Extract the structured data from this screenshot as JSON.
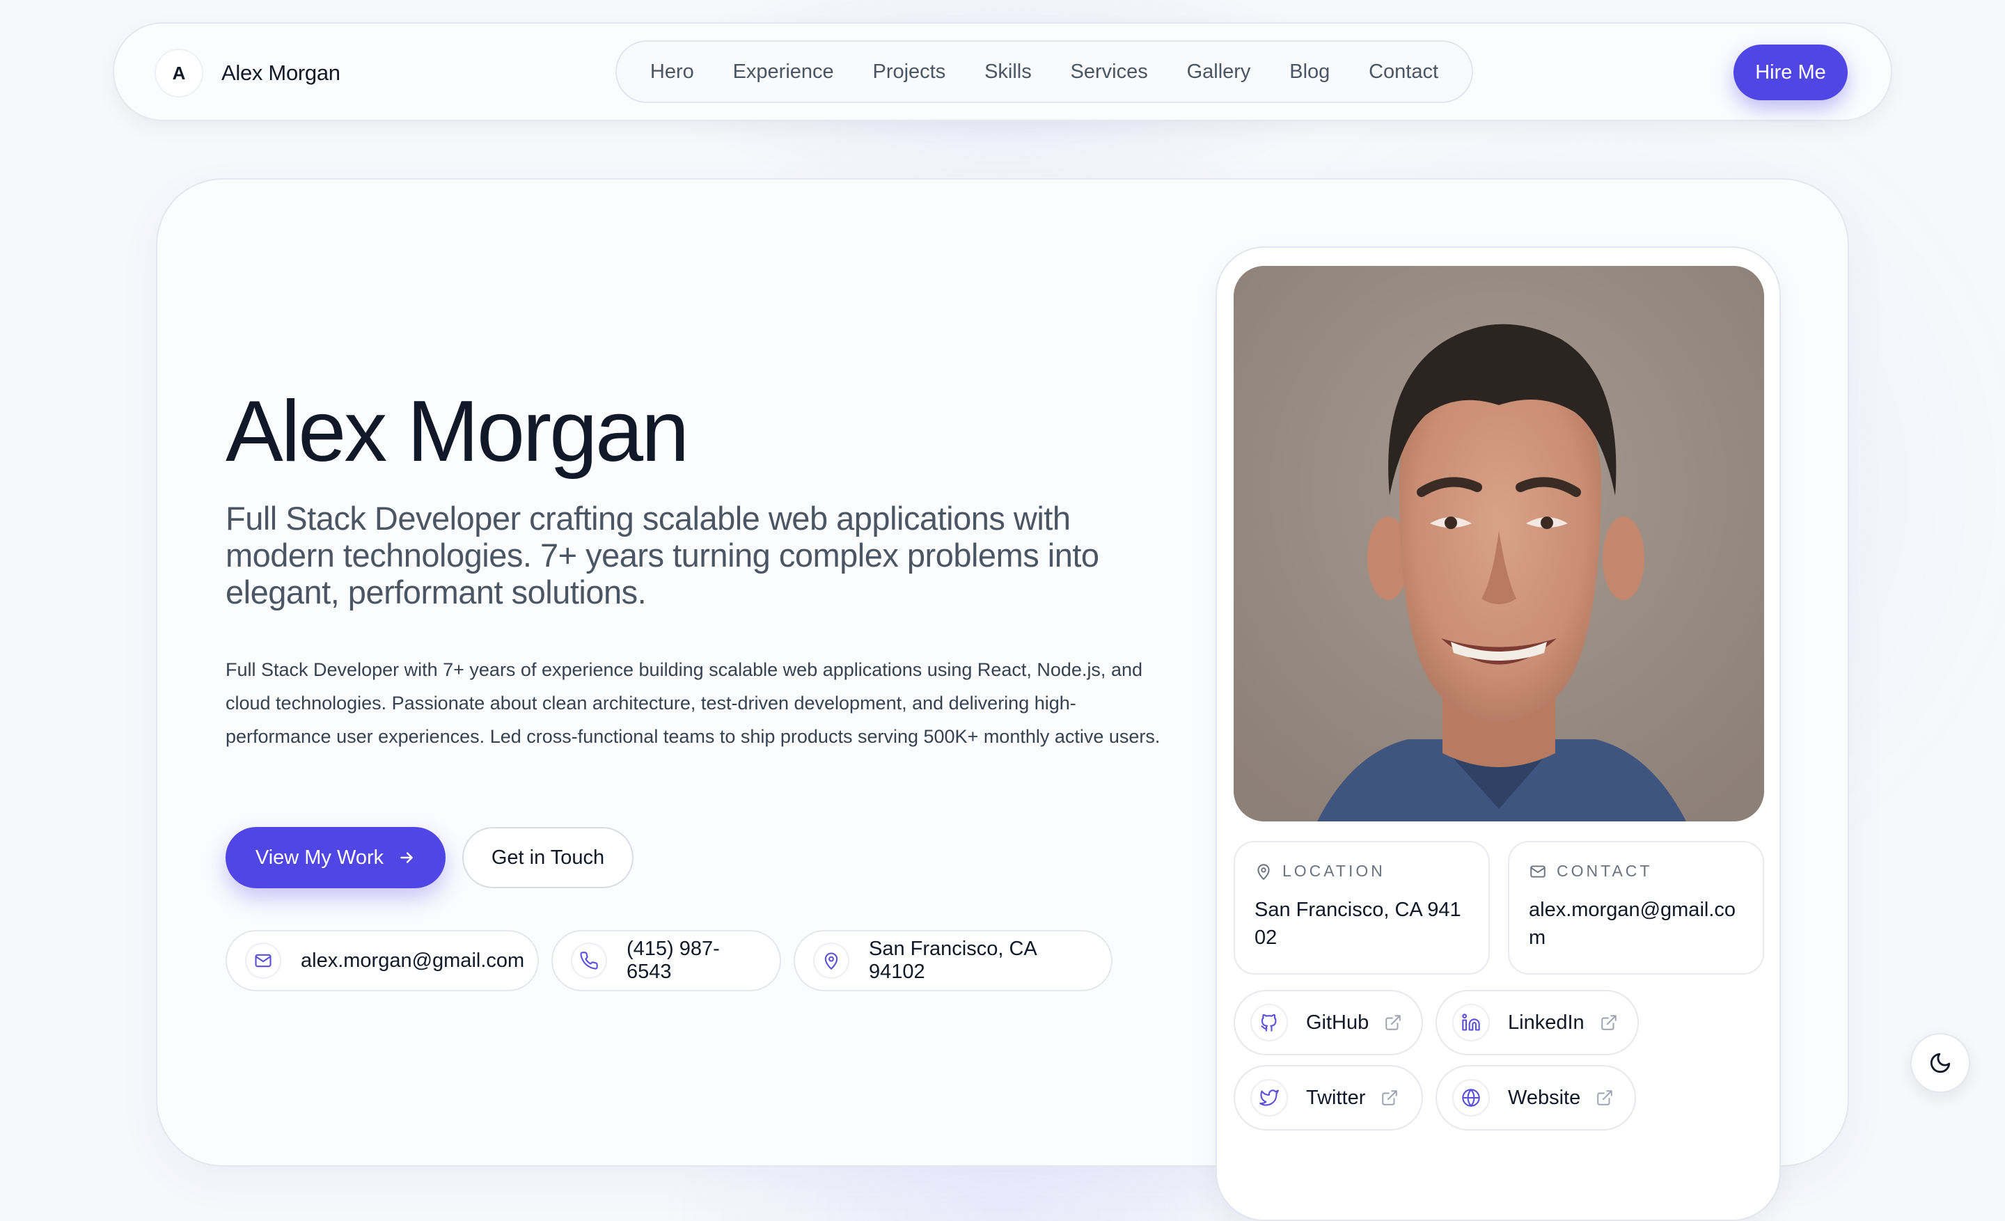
{
  "header": {
    "logo_initial": "A",
    "brand_name": "Alex Morgan",
    "nav": [
      "Hero",
      "Experience",
      "Projects",
      "Skills",
      "Services",
      "Gallery",
      "Blog",
      "Contact"
    ],
    "cta_label": "Hire Me"
  },
  "hero": {
    "name": "Alex Morgan",
    "tagline": "Full Stack Developer crafting scalable web applications with modern technologies. 7+ years turning complex problems into elegant, performant solutions.",
    "bio": "Full Stack Developer with 7+ years of experience building scalable web applications using React, Node.js, and cloud technologies. Passionate about clean architecture, test-driven development, and delivering high-performance user experiences. Led cross-functional teams to ship products serving 500K+ monthly active users.",
    "primary_button": "View My Work",
    "secondary_button": "Get in Touch",
    "contacts": {
      "email": "alex.morgan@gmail.com",
      "phone": "(415) 987-6543",
      "location": "San Francisco, CA 94102"
    }
  },
  "profile": {
    "location_label": "LOCATION",
    "location_value": "San Francisco, CA 94102",
    "contact_label": "CONTACT",
    "contact_value": "alex.morgan@gmail.com",
    "links": {
      "github": "GitHub",
      "linkedin": "LinkedIn",
      "twitter": "Twitter",
      "website": "Website"
    }
  },
  "icons": {
    "mail": "mail-icon",
    "phone": "phone-icon",
    "pin": "map-pin-icon",
    "arrow": "arrow-right-icon",
    "github": "github-icon",
    "linkedin": "linkedin-icon",
    "twitter": "twitter-icon",
    "globe": "globe-icon",
    "external": "external-link-icon",
    "moon": "moon-icon"
  },
  "colors": {
    "accent": "#4f46e5",
    "text": "#111827",
    "muted": "#4b5563",
    "icon_accent": "#5b4fd8"
  }
}
